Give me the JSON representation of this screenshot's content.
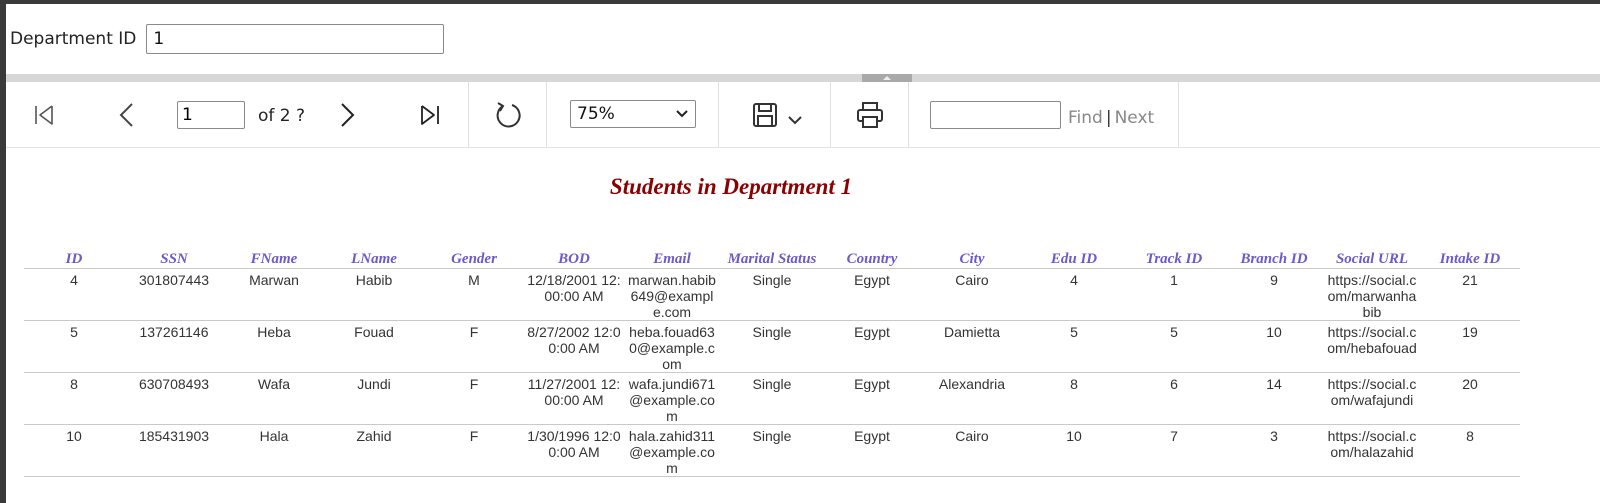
{
  "parameters": {
    "label": "Department ID",
    "value": "1"
  },
  "toolbar": {
    "page_input": "1",
    "of_pages": "of 2 ?",
    "zoom": "75%",
    "find_value": "",
    "find_label": "Find",
    "separator": "|",
    "next_label": "Next"
  },
  "report": {
    "title": "Students in Department 1",
    "columns": [
      "ID",
      "SSN",
      "FName",
      "LName",
      "Gender",
      "BOD",
      "Email",
      "Marital Status",
      "Country",
      "City",
      "Edu ID",
      "Track ID",
      "Branch ID",
      "Social URL",
      "Intake ID"
    ],
    "rows": [
      [
        "4",
        "301807443",
        "Marwan",
        "Habib",
        "M",
        "12/18/2001 12:00:00 AM",
        "marwan.habib649@example.com",
        "Single",
        "Egypt",
        "Cairo",
        "4",
        "1",
        "9",
        "https://social.com/marwanhabib",
        "21"
      ],
      [
        "5",
        "137261146",
        "Heba",
        "Fouad",
        "F",
        "8/27/2002 12:00:00 AM",
        "heba.fouad630@example.com",
        "Single",
        "Egypt",
        "Damietta",
        "5",
        "5",
        "10",
        "https://social.com/hebafouad",
        "19"
      ],
      [
        "8",
        "630708493",
        "Wafa",
        "Jundi",
        "F",
        "11/27/2001 12:00:00 AM",
        "wafa.jundi671@example.com",
        "Single",
        "Egypt",
        "Alexandria",
        "8",
        "6",
        "14",
        "https://social.com/wafajundi",
        "20"
      ],
      [
        "10",
        "185431903",
        "Hala",
        "Zahid",
        "F",
        "1/30/1996 12:00:00 AM",
        "hala.zahid311@example.com",
        "Single",
        "Egypt",
        "Cairo",
        "10",
        "7",
        "3",
        "https://social.com/halazahid",
        "8"
      ]
    ]
  },
  "colors": {
    "title": "#8b0000",
    "header": "#6a5acd"
  }
}
